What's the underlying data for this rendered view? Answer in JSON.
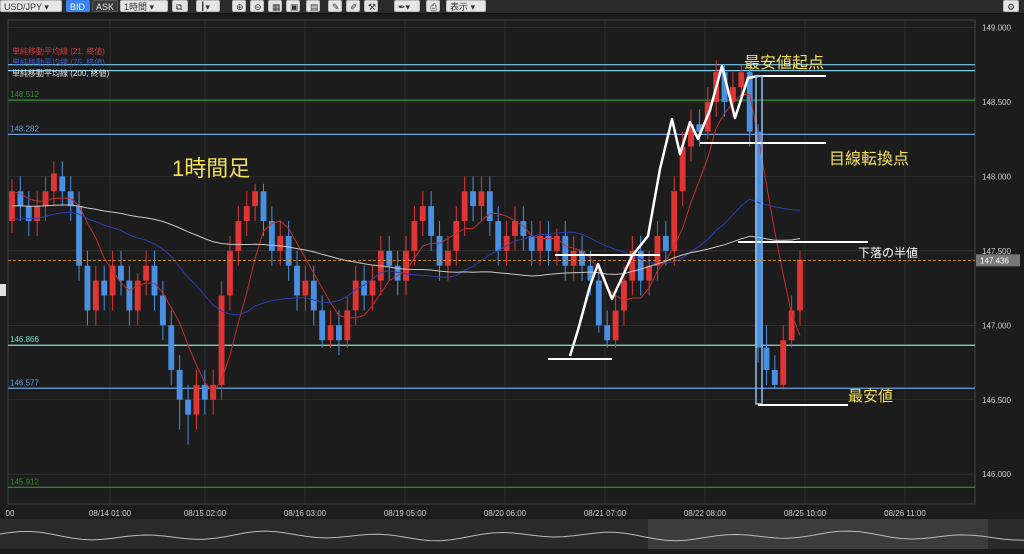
{
  "toolbar": {
    "symbol": "USD/JPY",
    "bid_label": "BID",
    "ask_label": "ASK",
    "timeframe": "1時間",
    "view_label": "表示"
  },
  "legend": [
    {
      "text": "単純移動平均線 (21, 終値)",
      "color": "#d33a3a"
    },
    {
      "text": "単純移動平均線 (75, 終値)",
      "color": "#3b5ccc"
    },
    {
      "text": "単純移動平均線 (200, 終値)",
      "color": "#e0e0e0"
    }
  ],
  "colors": {
    "background": "#1c1c1c",
    "grid": "#3a3a3a",
    "up": "#e03535",
    "down": "#4a90e2",
    "sma21": "#c33030",
    "sma75": "#2c3fb5",
    "sma200": "#c8c8c8",
    "annotation": "#ffffff",
    "annotation_text": "#f4e05a",
    "current_price": "#f0a030"
  },
  "chart_data": {
    "type": "candlestick",
    "title": "1時間足",
    "ylim": [
      145.8,
      149.05
    ],
    "y_ticks": [
      "149.000",
      "148.500",
      "148.000",
      "147.500",
      "147.000",
      "146.500",
      "146.000"
    ],
    "x_labels": [
      "00",
      "08/14 01:00",
      "08/15 02:00",
      "08/16 03:00",
      "08/19 05:00",
      "08/20 06:00",
      "08/21 07:00",
      "08/22 08:00",
      "08/25 10:00",
      "08/26 11:00"
    ],
    "horizontal_lines": [
      {
        "price": 148.75,
        "color": "#7ec8ee",
        "label": ""
      },
      {
        "price": 148.71,
        "color": "#7ec8ee",
        "label": ""
      },
      {
        "price": 148.512,
        "color": "#3a8c3a",
        "label": "148.512"
      },
      {
        "price": 148.282,
        "color": "#6aa0e0",
        "label": "148.282"
      },
      {
        "price": 146.866,
        "color": "#7ee0d0",
        "label": "146.866"
      },
      {
        "price": 146.577,
        "color": "#6aa0e0",
        "label": "146.577"
      },
      {
        "price": 145.912,
        "color": "#3a8c3a",
        "label": "145.912"
      }
    ],
    "current_price": 147.436,
    "current_price_label": "147.436",
    "annotations": [
      {
        "text": "最安値起点"
      },
      {
        "text": "目線転換点"
      },
      {
        "text": "下落の半値"
      },
      {
        "text": "最安値"
      }
    ],
    "candles": [
      {
        "o": 147.7,
        "c": 147.9,
        "h": 147.98,
        "l": 147.62
      },
      {
        "o": 147.9,
        "c": 147.8,
        "h": 148.0,
        "l": 147.7
      },
      {
        "o": 147.8,
        "c": 147.7,
        "h": 147.9,
        "l": 147.6
      },
      {
        "o": 147.7,
        "c": 147.8,
        "h": 147.9,
        "l": 147.6
      },
      {
        "o": 147.8,
        "c": 147.9,
        "h": 148.0,
        "l": 147.7
      },
      {
        "o": 147.9,
        "c": 148.02,
        "h": 148.1,
        "l": 147.8
      },
      {
        "o": 148.0,
        "c": 147.9,
        "h": 148.1,
        "l": 147.8
      },
      {
        "o": 147.9,
        "c": 147.8,
        "h": 148.0,
        "l": 147.7
      },
      {
        "o": 147.8,
        "c": 147.4,
        "h": 147.9,
        "l": 147.3
      },
      {
        "o": 147.4,
        "c": 147.1,
        "h": 147.5,
        "l": 147.0
      },
      {
        "o": 147.1,
        "c": 147.3,
        "h": 147.4,
        "l": 147.0
      },
      {
        "o": 147.3,
        "c": 147.2,
        "h": 147.4,
        "l": 147.1
      },
      {
        "o": 147.2,
        "c": 147.4,
        "h": 147.5,
        "l": 147.1
      },
      {
        "o": 147.4,
        "c": 147.3,
        "h": 147.5,
        "l": 147.2
      },
      {
        "o": 147.3,
        "c": 147.1,
        "h": 147.4,
        "l": 147.0
      },
      {
        "o": 147.1,
        "c": 147.3,
        "h": 147.35,
        "l": 147.0
      },
      {
        "o": 147.3,
        "c": 147.4,
        "h": 147.5,
        "l": 147.2
      },
      {
        "o": 147.4,
        "c": 147.2,
        "h": 147.5,
        "l": 147.1
      },
      {
        "o": 147.2,
        "c": 147.0,
        "h": 147.3,
        "l": 146.9
      },
      {
        "o": 147.0,
        "c": 146.7,
        "h": 147.1,
        "l": 146.6
      },
      {
        "o": 146.7,
        "c": 146.5,
        "h": 146.8,
        "l": 146.3
      },
      {
        "o": 146.5,
        "c": 146.4,
        "h": 146.6,
        "l": 146.2
      },
      {
        "o": 146.4,
        "c": 146.6,
        "h": 146.7,
        "l": 146.3
      },
      {
        "o": 146.6,
        "c": 146.5,
        "h": 146.7,
        "l": 146.4
      },
      {
        "o": 146.5,
        "c": 146.6,
        "h": 146.7,
        "l": 146.4
      },
      {
        "o": 146.6,
        "c": 147.2,
        "h": 147.3,
        "l": 146.5
      },
      {
        "o": 147.2,
        "c": 147.5,
        "h": 147.6,
        "l": 147.1
      },
      {
        "o": 147.5,
        "c": 147.7,
        "h": 147.8,
        "l": 147.4
      },
      {
        "o": 147.7,
        "c": 147.8,
        "h": 147.9,
        "l": 147.6
      },
      {
        "o": 147.8,
        "c": 147.9,
        "h": 147.95,
        "l": 147.7
      },
      {
        "o": 147.9,
        "c": 147.7,
        "h": 147.95,
        "l": 147.6
      },
      {
        "o": 147.7,
        "c": 147.5,
        "h": 147.8,
        "l": 147.4
      },
      {
        "o": 147.5,
        "c": 147.6,
        "h": 147.7,
        "l": 147.4
      },
      {
        "o": 147.6,
        "c": 147.4,
        "h": 147.7,
        "l": 147.3
      },
      {
        "o": 147.4,
        "c": 147.2,
        "h": 147.5,
        "l": 147.1
      },
      {
        "o": 147.2,
        "c": 147.3,
        "h": 147.4,
        "l": 147.1
      },
      {
        "o": 147.3,
        "c": 147.1,
        "h": 147.4,
        "l": 147.0
      },
      {
        "o": 147.1,
        "c": 146.9,
        "h": 147.2,
        "l": 146.85
      },
      {
        "o": 146.9,
        "c": 147.0,
        "h": 147.1,
        "l": 146.85
      },
      {
        "o": 147.0,
        "c": 146.9,
        "h": 147.1,
        "l": 146.8
      },
      {
        "o": 146.9,
        "c": 147.1,
        "h": 147.2,
        "l": 146.85
      },
      {
        "o": 147.1,
        "c": 147.3,
        "h": 147.4,
        "l": 147.0
      },
      {
        "o": 147.3,
        "c": 147.2,
        "h": 147.4,
        "l": 147.1
      },
      {
        "o": 147.2,
        "c": 147.3,
        "h": 147.4,
        "l": 147.1
      },
      {
        "o": 147.3,
        "c": 147.5,
        "h": 147.6,
        "l": 147.2
      },
      {
        "o": 147.5,
        "c": 147.4,
        "h": 147.6,
        "l": 147.3
      },
      {
        "o": 147.4,
        "c": 147.3,
        "h": 147.5,
        "l": 147.2
      },
      {
        "o": 147.3,
        "c": 147.5,
        "h": 147.6,
        "l": 147.2
      },
      {
        "o": 147.5,
        "c": 147.7,
        "h": 147.8,
        "l": 147.4
      },
      {
        "o": 147.7,
        "c": 147.8,
        "h": 147.9,
        "l": 147.6
      },
      {
        "o": 147.8,
        "c": 147.6,
        "h": 147.9,
        "l": 147.5
      },
      {
        "o": 147.6,
        "c": 147.4,
        "h": 147.7,
        "l": 147.3
      },
      {
        "o": 147.4,
        "c": 147.5,
        "h": 147.6,
        "l": 147.3
      },
      {
        "o": 147.5,
        "c": 147.7,
        "h": 147.8,
        "l": 147.4
      },
      {
        "o": 147.7,
        "c": 147.9,
        "h": 148.0,
        "l": 147.6
      },
      {
        "o": 147.9,
        "c": 147.8,
        "h": 148.0,
        "l": 147.7
      },
      {
        "o": 147.8,
        "c": 147.9,
        "h": 148.0,
        "l": 147.7
      },
      {
        "o": 147.9,
        "c": 147.7,
        "h": 148.0,
        "l": 147.6
      },
      {
        "o": 147.7,
        "c": 147.5,
        "h": 147.8,
        "l": 147.4
      },
      {
        "o": 147.5,
        "c": 147.6,
        "h": 147.7,
        "l": 147.4
      },
      {
        "o": 147.6,
        "c": 147.7,
        "h": 147.8,
        "l": 147.5
      },
      {
        "o": 147.7,
        "c": 147.6,
        "h": 147.8,
        "l": 147.5
      },
      {
        "o": 147.6,
        "c": 147.5,
        "h": 147.7,
        "l": 147.4
      },
      {
        "o": 147.5,
        "c": 147.6,
        "h": 147.7,
        "l": 147.4
      },
      {
        "o": 147.6,
        "c": 147.5,
        "h": 147.7,
        "l": 147.4
      },
      {
        "o": 147.5,
        "c": 147.6,
        "h": 147.65,
        "l": 147.4
      },
      {
        "o": 147.6,
        "c": 147.4,
        "h": 147.7,
        "l": 147.3
      },
      {
        "o": 147.4,
        "c": 147.5,
        "h": 147.6,
        "l": 147.3
      },
      {
        "o": 147.5,
        "c": 147.4,
        "h": 147.6,
        "l": 147.3
      },
      {
        "o": 147.4,
        "c": 147.3,
        "h": 147.5,
        "l": 147.2
      },
      {
        "o": 147.3,
        "c": 147.0,
        "h": 147.4,
        "l": 146.95
      },
      {
        "o": 147.0,
        "c": 146.9,
        "h": 147.1,
        "l": 146.85
      },
      {
        "o": 146.9,
        "c": 147.1,
        "h": 147.2,
        "l": 146.85
      },
      {
        "o": 147.1,
        "c": 147.3,
        "h": 147.4,
        "l": 147.0
      },
      {
        "o": 147.3,
        "c": 147.5,
        "h": 147.6,
        "l": 147.2
      },
      {
        "o": 147.5,
        "c": 147.3,
        "h": 147.6,
        "l": 147.2
      },
      {
        "o": 147.3,
        "c": 147.4,
        "h": 147.5,
        "l": 147.2
      },
      {
        "o": 147.4,
        "c": 147.6,
        "h": 147.7,
        "l": 147.3
      },
      {
        "o": 147.6,
        "c": 147.5,
        "h": 147.7,
        "l": 147.4
      },
      {
        "o": 147.5,
        "c": 147.9,
        "h": 148.0,
        "l": 147.4
      },
      {
        "o": 147.9,
        "c": 148.2,
        "h": 148.3,
        "l": 147.8
      },
      {
        "o": 148.2,
        "c": 148.35,
        "h": 148.45,
        "l": 148.1
      },
      {
        "o": 148.35,
        "c": 148.3,
        "h": 148.45,
        "l": 148.2
      },
      {
        "o": 148.3,
        "c": 148.5,
        "h": 148.6,
        "l": 148.25
      },
      {
        "o": 148.5,
        "c": 148.7,
        "h": 148.78,
        "l": 148.4
      },
      {
        "o": 148.7,
        "c": 148.5,
        "h": 148.75,
        "l": 148.4
      },
      {
        "o": 148.5,
        "c": 148.6,
        "h": 148.7,
        "l": 148.4
      },
      {
        "o": 148.6,
        "c": 148.7,
        "h": 148.75,
        "l": 148.5
      },
      {
        "o": 148.7,
        "c": 148.3,
        "h": 148.72,
        "l": 148.2
      },
      {
        "o": 148.3,
        "c": 146.85,
        "h": 148.35,
        "l": 146.75
      },
      {
        "o": 146.85,
        "c": 146.7,
        "h": 147.0,
        "l": 146.6
      },
      {
        "o": 146.7,
        "c": 146.6,
        "h": 146.8,
        "l": 146.58
      },
      {
        "o": 146.6,
        "c": 146.9,
        "h": 147.0,
        "l": 146.58
      },
      {
        "o": 146.9,
        "c": 147.1,
        "h": 147.2,
        "l": 146.85
      },
      {
        "o": 147.1,
        "c": 147.44,
        "h": 147.5,
        "l": 147.0
      }
    ]
  }
}
